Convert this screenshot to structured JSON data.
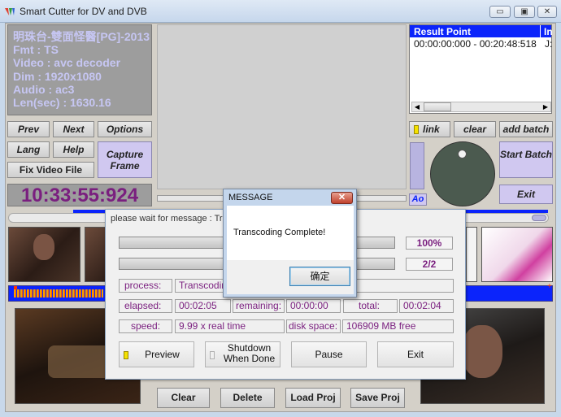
{
  "window": {
    "title": "Smart Cutter for DV and DVB",
    "controls": [
      "▭",
      "▣",
      "✕"
    ]
  },
  "file_info": {
    "name": "明珠台-雙面怪醫[PG]-2013",
    "fmt": "Fmt : TS",
    "video": "Video : avc decoder",
    "dim": "Dim : 1920x1080",
    "audio": "Audio : ac3",
    "length": "Len(sec) : 1630.16"
  },
  "result_list": {
    "headers": [
      "Result Point",
      "In"
    ],
    "rows": [
      {
        "range": "00:00:00:000 - 00:20:48:518",
        "extra": "J:"
      }
    ]
  },
  "buttons": {
    "prev": "Prev",
    "next": "Next",
    "options": "Options",
    "lang": "Lang",
    "help": "Help",
    "capture_frame": "Capture Frame",
    "fix_video_file": "Fix Video File",
    "link": "link",
    "clear_top": "clear",
    "add_batch": "add batch",
    "start_batch": "Start Batch",
    "exit_main": "Exit",
    "ao": "Ao",
    "clear": "Clear",
    "delete": "Delete",
    "load_proj": "Load Proj",
    "save_proj": "Save Proj"
  },
  "timecode": "10:33:55:924",
  "progress_dialog": {
    "title": "please wait for message : Tr",
    "bar1_percent": "100%",
    "bar1_fraction": 1.0,
    "bar2_count": "2/2",
    "bar2_fraction": 1.0,
    "process_label": "process:",
    "process_value": "Transcodin",
    "elapsed_label": "elapsed:",
    "elapsed_value": "00:02:05",
    "remaining_label": "remaining:",
    "remaining_value": "00:00:00",
    "total_label": "total:",
    "total_value": "00:02:04",
    "speed_label": "speed:",
    "speed_value": "9.99 x real time",
    "disk_label": "disk space:",
    "disk_value": "106909 MB free",
    "preview_btn": "Preview",
    "shutdown_btn": "Shutdown When Done",
    "pause_btn": "Pause",
    "exit_btn": "Exit"
  },
  "message_box": {
    "title": "MESSAGE",
    "text": "Transcoding Complete!",
    "ok_button": "确定"
  },
  "colors": {
    "accent_blue": "#0b24fb",
    "purple_text": "#7a1f7f",
    "lavender": "#d0c8f0"
  }
}
